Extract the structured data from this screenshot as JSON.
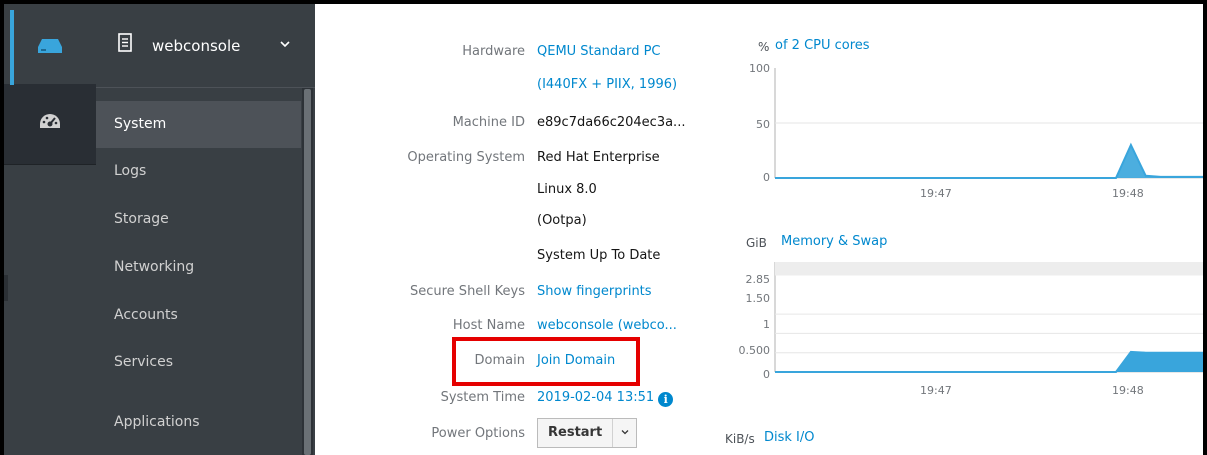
{
  "host": {
    "name": "webconsole"
  },
  "nav": {
    "items": [
      {
        "label": "System",
        "active": true
      },
      {
        "label": "Logs"
      },
      {
        "label": "Storage"
      },
      {
        "label": "Networking"
      },
      {
        "label": "Accounts"
      },
      {
        "label": "Services"
      },
      {
        "label": "Applications"
      }
    ]
  },
  "info": {
    "hardware_label": "Hardware",
    "hardware_line1": "QEMU Standard PC",
    "hardware_line2": "(I440FX + PIIX, 1996)",
    "machine_id_label": "Machine ID",
    "machine_id": "e89c7da66c204ec3a...",
    "os_label": "Operating System",
    "os_line1": "Red Hat Enterprise",
    "os_line2": "Linux 8.0",
    "os_line3": "(Ootpa)",
    "updates": "System Up To Date",
    "ssh_label": "Secure Shell Keys",
    "ssh_value": "Show fingerprints",
    "hostname_label": "Host Name",
    "hostname_value": "webconsole (webco...",
    "domain_label": "Domain",
    "domain_value": "Join Domain",
    "time_label": "System Time",
    "time_value": "2019-02-04 13:51",
    "power_label": "Power Options",
    "restart_label": "Restart"
  },
  "cpu_chart": {
    "unit": "%",
    "title": "of 2 CPU cores",
    "yticks": [
      "100",
      "50",
      "0"
    ],
    "xticks": [
      "19:47",
      "19:48"
    ]
  },
  "mem_chart": {
    "unit": "GiB",
    "title": "Memory & Swap",
    "yticks": [
      "2.85",
      "1.50",
      "1",
      "0.500",
      "0"
    ],
    "xticks": [
      "19:47",
      "19:48"
    ]
  },
  "disk_chart": {
    "unit": "KiB/s",
    "title": "Disk I/O"
  },
  "colors": {
    "accent": "#0088ce",
    "chart_fill": "#39a5dc",
    "nav_bg": "#393f44",
    "highlight": "#e50000"
  },
  "chart_data": [
    {
      "type": "area",
      "title": "of 2 CPU cores",
      "ylabel": "%",
      "ylim": [
        0,
        100
      ],
      "xticks": [
        "19:47",
        "19:48"
      ],
      "series": [
        {
          "values": [
            0,
            0,
            0,
            0,
            0,
            0,
            0,
            0,
            0,
            0,
            0,
            0,
            0,
            0,
            0,
            0,
            0,
            0,
            0,
            0,
            0,
            0,
            0,
            0,
            30,
            2,
            1,
            1,
            1,
            1
          ]
        }
      ]
    },
    {
      "type": "area",
      "title": "Memory & Swap",
      "ylabel": "GiB",
      "ylim": [
        0,
        2.85
      ],
      "xticks": [
        "19:47",
        "19:48"
      ],
      "series": [
        {
          "values": [
            0,
            0,
            0,
            0,
            0,
            0,
            0,
            0,
            0,
            0,
            0,
            0,
            0,
            0,
            0,
            0,
            0,
            0,
            0,
            0,
            0,
            0,
            0,
            0,
            0.52,
            0.5,
            0.5,
            0.5,
            0.5,
            0.5
          ]
        }
      ]
    }
  ]
}
